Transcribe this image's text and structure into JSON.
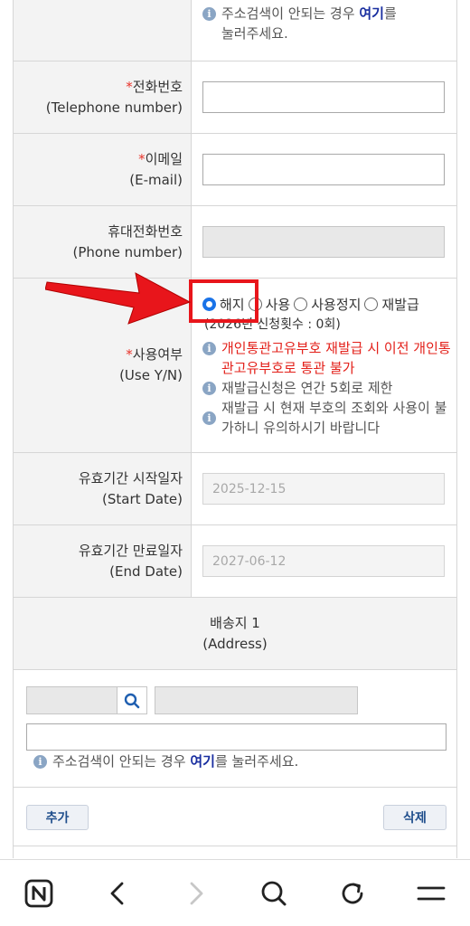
{
  "top_note": {
    "line1": "주소검색이 안되는 경우",
    "link": "여기",
    "line1_after": "를",
    "line2": "눌러주세요."
  },
  "required_mark": "*",
  "telephone": {
    "label_ko": "전화번호",
    "label_en": "(Telephone number)",
    "value": ""
  },
  "email": {
    "label_ko": "이메일",
    "label_en": "(E-mail)",
    "value": ""
  },
  "phone": {
    "label_ko": "휴대전화번호",
    "label_en": "(Phone number)",
    "value": ""
  },
  "use_status": {
    "label_ko": "사용여부",
    "label_en": "(Use Y/N)",
    "options": [
      "해지",
      "사용",
      "사용정지",
      "재발급"
    ],
    "selected": "해지",
    "count_text": "(2026년 신청횟수 : 0회)",
    "notes": [
      {
        "text": "개인통관고유부호 재발급 시 이전 개인통관고유부호로 통관 불가",
        "color": "#e3201a"
      },
      {
        "text": "재발급신청은 연간 5회로 제한",
        "color": "#555555"
      },
      {
        "text": "재발급 시 현재 부호의 조회와 사용이 불가하니 유의하시기 바랍니다",
        "color": "#555555"
      }
    ]
  },
  "start_date": {
    "label_ko": "유효기간 시작일자",
    "label_en": "(Start Date)",
    "value": "2025-12-15"
  },
  "end_date": {
    "label_ko": "유효기간 만료일자",
    "label_en": "(End Date)",
    "value": "2027-06-12"
  },
  "address": {
    "header_ko": "배송지 1",
    "header_en": "(Address)",
    "note": {
      "before": "주소검색이 안되는 경우",
      "link": "여기",
      "after": "를 눌러주세요."
    },
    "add_label": "추가",
    "delete_label": "삭제"
  },
  "browser_nav": {
    "icons": [
      "naver-home-icon",
      "back-icon",
      "forward-icon",
      "search-icon",
      "refresh-icon",
      "menu-icon"
    ]
  },
  "colors": {
    "required": "#e8332a",
    "link": "#1a2fa0",
    "radio_selected": "#1a73e8",
    "highlight_box": "#e8151b",
    "arrow": "#e8151b",
    "warning_text": "#e3201a"
  }
}
